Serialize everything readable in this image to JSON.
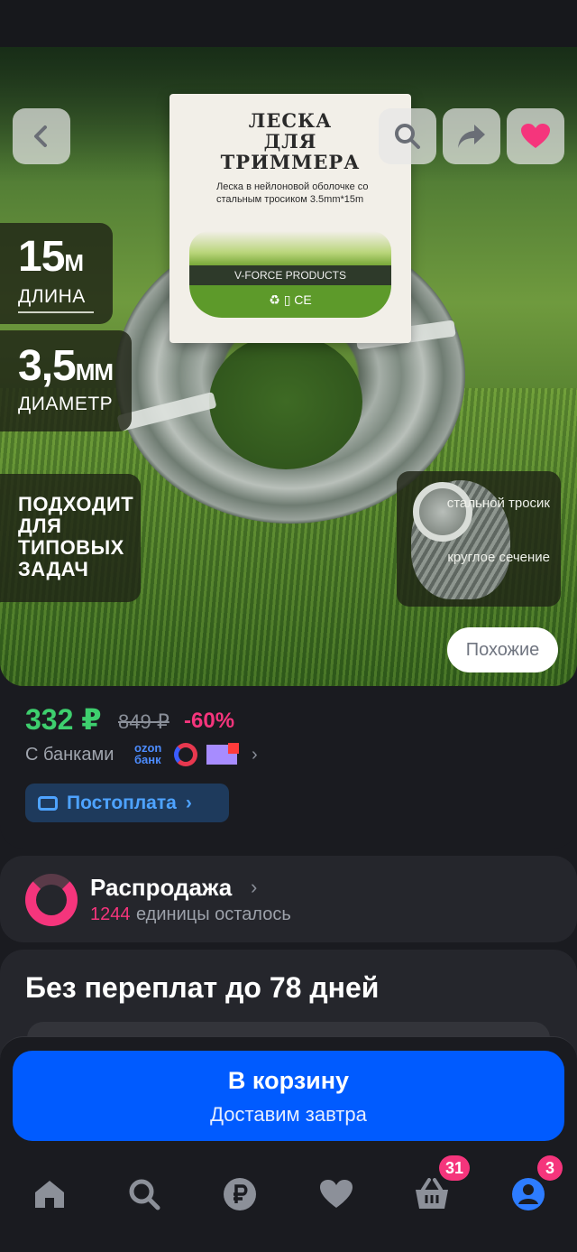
{
  "hero": {
    "product_title": "ЛЕСКА\nДЛЯ\nТРИММЕРА",
    "product_sub": "Леска в нейлоновой оболочке со стальным тросиком 3.5mm*15m",
    "brand": "V-FORCE PRODUCTS",
    "marks": "♻ ▯ CE",
    "length_value": "15",
    "length_unit": "М",
    "length_label": "ДЛИНА",
    "diameter_value": "3,5",
    "diameter_unit": "ММ",
    "diameter_label": "ДИАМЕТР",
    "suits_text": "ПОДХОДИТ\nДЛЯ\nТИПОВЫХ\nЗАДАЧ",
    "cable_label_1": "стальной\nтросик",
    "cable_label_2": "круглое\nсечение",
    "similar_label": "Похожие"
  },
  "price": {
    "current": "332 ₽",
    "old": "849 ₽",
    "discount": "-60%",
    "banks_label": "С банками",
    "ozon_bank": "ozon\nбанк",
    "postpay_label": "Постоплата"
  },
  "sale": {
    "title": "Распродажа",
    "count": "1244",
    "rest": "единицы осталось"
  },
  "bnpl": {
    "title": "Без переплат до 78 дней"
  },
  "cart": {
    "label": "В корзину",
    "sub": "Доставим завтра"
  },
  "nav": {
    "cart_badge": "31",
    "profile_badge": "3"
  },
  "colors": {
    "accent": "#005bff",
    "price_green": "#3ecf6e",
    "discount_pink": "#f5357c",
    "background": "#1a1b20"
  }
}
